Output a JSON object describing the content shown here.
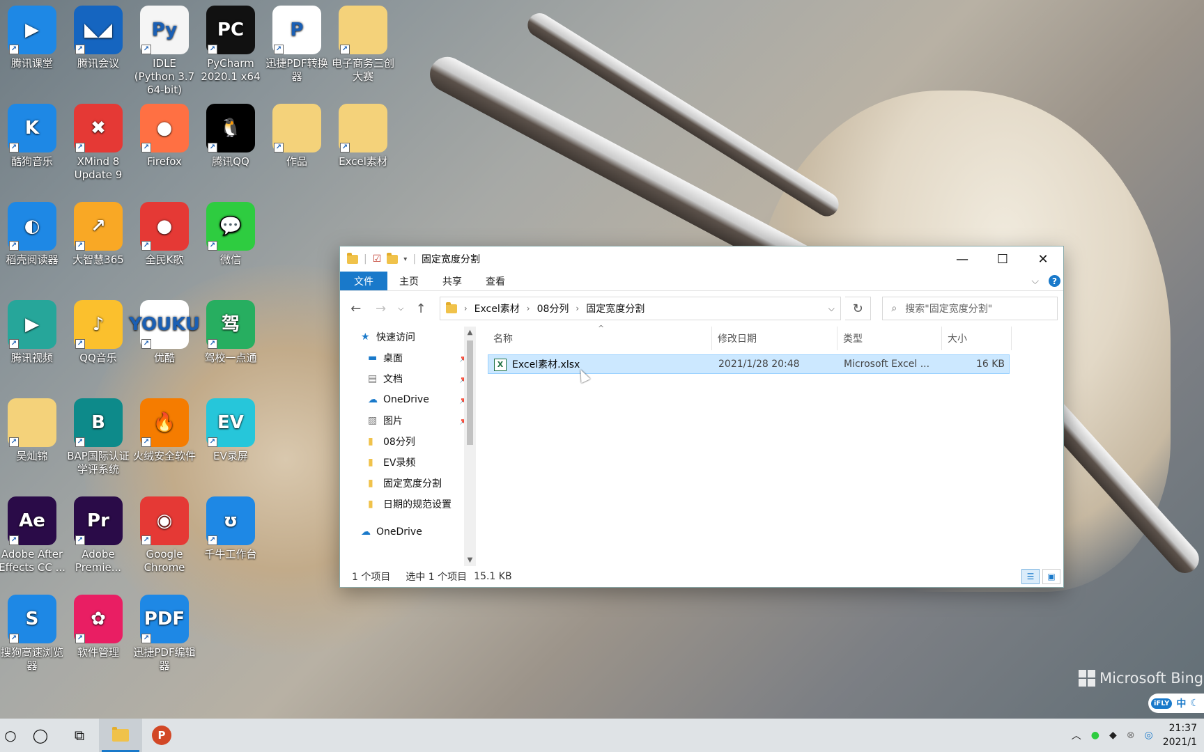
{
  "desktop": {
    "icons": [
      {
        "label": "腾讯课堂",
        "glyph": "▶",
        "color": "#1e88e5"
      },
      {
        "label": "腾讯会议",
        "glyph": "◣◢",
        "color": "#1565c0"
      },
      {
        "label": "IDLE (Python 3.7 64-bit)",
        "glyph": "Py",
        "color": "#f5f5f5"
      },
      {
        "label": "PyCharm 2020.1 x64",
        "glyph": "PC",
        "color": "#111111"
      },
      {
        "label": "迅捷PDF转换器",
        "glyph": "P",
        "color": "#ffffff"
      },
      {
        "label": "电子商务三创大赛",
        "glyph": "",
        "color": "#f4d27a"
      },
      {
        "label": "酷狗音乐",
        "glyph": "K",
        "color": "#1e88e5"
      },
      {
        "label": "XMind 8 Update 9",
        "glyph": "✖",
        "color": "#e53935"
      },
      {
        "label": "Firefox",
        "glyph": "●",
        "color": "#ff7043"
      },
      {
        "label": "腾讯QQ",
        "glyph": "🐧",
        "color": "#000000"
      },
      {
        "label": "作品",
        "glyph": "",
        "color": "#f4d27a"
      },
      {
        "label": "Excel素材",
        "glyph": "",
        "color": "#f4d27a"
      },
      {
        "label": "稻壳阅读器",
        "glyph": "◐",
        "color": "#1e88e5"
      },
      {
        "label": "大智慧365",
        "glyph": "↗",
        "color": "#f9a825"
      },
      {
        "label": "全民K歌",
        "glyph": "●",
        "color": "#e53935"
      },
      {
        "label": "微信",
        "glyph": "💬",
        "color": "#2ecc40"
      },
      {
        "label": "腾讯视频",
        "glyph": "▶",
        "color": "#26a69a"
      },
      {
        "label": "QQ音乐",
        "glyph": "♪",
        "color": "#fbc02d"
      },
      {
        "label": "优酷",
        "glyph": "YOUKU",
        "color": "#ffffff"
      },
      {
        "label": "驾校一点通",
        "glyph": "驾",
        "color": "#27ae60"
      },
      {
        "label": "吴灿锦",
        "glyph": "",
        "color": "#f4d27a"
      },
      {
        "label": "BAP国际认证学评系统",
        "glyph": "B",
        "color": "#0d8a8a"
      },
      {
        "label": "火绒安全软件",
        "glyph": "🔥",
        "color": "#f57c00"
      },
      {
        "label": "EV录屏",
        "glyph": "EV",
        "color": "#26c6da"
      },
      {
        "label": "Adobe After Effects CC ...",
        "glyph": "Ae",
        "color": "#2a0b48"
      },
      {
        "label": "Adobe Premie...",
        "glyph": "Pr",
        "color": "#2a0b48"
      },
      {
        "label": "Google Chrome",
        "glyph": "◉",
        "color": "#e53935"
      },
      {
        "label": "千牛工作台",
        "glyph": "ʊ",
        "color": "#1e88e5"
      },
      {
        "label": "搜狗高速浏览器",
        "glyph": "S",
        "color": "#1e88e5"
      },
      {
        "label": "软件管理",
        "glyph": "✿",
        "color": "#e91e63"
      },
      {
        "label": "迅捷PDF编辑器",
        "glyph": "PDF",
        "color": "#1e88e5"
      }
    ]
  },
  "window": {
    "title": "固定宽度分割",
    "minimize": "—",
    "maximize": "☐",
    "close": "✕",
    "ribbon_tabs": [
      "文件",
      "主页",
      "共享",
      "查看"
    ],
    "address": [
      "Excel素材",
      "08分列",
      "固定宽度分割"
    ],
    "search_placeholder": "搜索\"固定宽度分割\"",
    "nav_items": [
      {
        "label": "快速访问",
        "icon": "star-icon",
        "indent": 1,
        "pinned": false
      },
      {
        "label": "桌面",
        "icon": "desktop-icon",
        "indent": 2,
        "pinned": true
      },
      {
        "label": "文档",
        "icon": "document-icon",
        "indent": 2,
        "pinned": true
      },
      {
        "label": "OneDrive",
        "icon": "cloud-icon",
        "indent": 2,
        "pinned": true
      },
      {
        "label": "图片",
        "icon": "picture-icon",
        "indent": 2,
        "pinned": true
      },
      {
        "label": "08分列",
        "icon": "folder-icon",
        "indent": 2,
        "pinned": false
      },
      {
        "label": "EV录频",
        "icon": "folder-icon",
        "indent": 2,
        "pinned": false
      },
      {
        "label": "固定宽度分割",
        "icon": "folder-icon",
        "indent": 2,
        "pinned": false
      },
      {
        "label": "日期的规范设置",
        "icon": "folder-icon",
        "indent": 2,
        "pinned": false
      },
      {
        "label": "OneDrive",
        "icon": "cloud-icon",
        "indent": 1,
        "pinned": false
      }
    ],
    "columns": {
      "name": "名称",
      "modified": "修改日期",
      "type": "类型",
      "size": "大小"
    },
    "files": [
      {
        "name": "Excel素材.xlsx",
        "modified": "2021/1/28 20:48",
        "type": "Microsoft Excel ...",
        "size": "16 KB"
      }
    ],
    "status": {
      "count": "1 个项目",
      "selected": "选中 1 个项目",
      "selected_size": "15.1 KB"
    }
  },
  "taskbar": {
    "clock_time": "21:37",
    "clock_date": "2021/1"
  },
  "ime": {
    "logo": "iFLY",
    "mode": "中"
  },
  "wallpaper": {
    "brand": "Microsoft Bing"
  }
}
